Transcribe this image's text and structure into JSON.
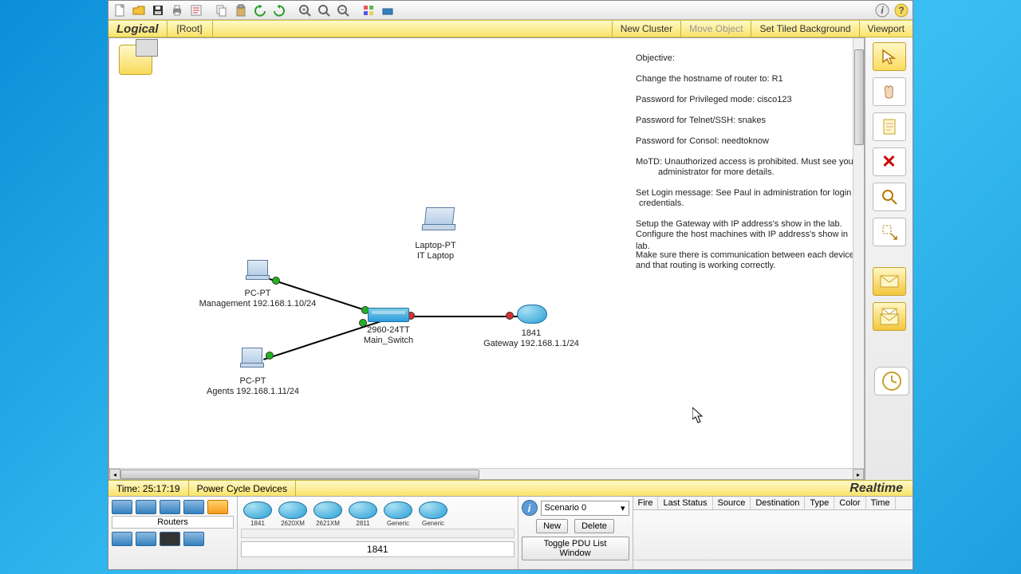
{
  "toolbar": {
    "tooltips": [
      "new",
      "open",
      "save",
      "print",
      "activity",
      "copy",
      "paste",
      "undo",
      "redo",
      "zoom-in",
      "zoom-reset",
      "zoom-out",
      "palette",
      "custom",
      "info",
      "help"
    ]
  },
  "logical": {
    "title": "Logical",
    "root": "[Root]",
    "new_cluster": "New Cluster",
    "move_object": "Move Object",
    "tiled_bg": "Set Tiled Background",
    "viewport": "Viewport"
  },
  "objective": {
    "heading": "Objective:",
    "l1": "Change the hostname of router to: R1",
    "l2": "Password for Privileged mode: cisco123",
    "l3": "Password for Telnet/SSH: snakes",
    "l4": "Password for Consol: needtoknow",
    "l5": "MoTD: Unauthorized access is prohibited. Must see your",
    "l5b": "administrator for more details.",
    "l6": "Set Login message: See Paul in administration for login",
    "l6b": "credentials.",
    "l7": "Setup the Gateway with IP address's show in the lab.",
    "l7b": "Configure the host machines with IP address's show in lab.",
    "l8": "Make sure there is communication between each device,",
    "l8b": "and that routing is working correctly."
  },
  "devices": {
    "laptop": {
      "type": "Laptop-PT",
      "name": "IT Laptop"
    },
    "pc1": {
      "type": "PC-PT",
      "label": "Management 192.168.1.10/24"
    },
    "pc2": {
      "type": "PC-PT",
      "label": "Agents 192.168.1.11/24"
    },
    "switch": {
      "model": "2960-24TT",
      "name": "Main_Switch"
    },
    "router": {
      "model": "1841",
      "label": "Gateway 192.168.1.1/24"
    }
  },
  "status": {
    "time_label": "Time: 25:17:19",
    "power_cycle": "Power Cycle Devices",
    "realtime": "Realtime"
  },
  "palette": {
    "category": "Routers",
    "models": [
      "1841",
      "2620XM",
      "2621XM",
      "2811",
      "Generic",
      "Generic"
    ],
    "selected": "1841"
  },
  "scenario": {
    "selected": "Scenario 0",
    "new_btn": "New",
    "delete_btn": "Delete",
    "toggle_btn": "Toggle PDU List Window"
  },
  "pdu_columns": [
    "Fire",
    "Last Status",
    "Source",
    "Destination",
    "Type",
    "Color",
    "Time"
  ]
}
